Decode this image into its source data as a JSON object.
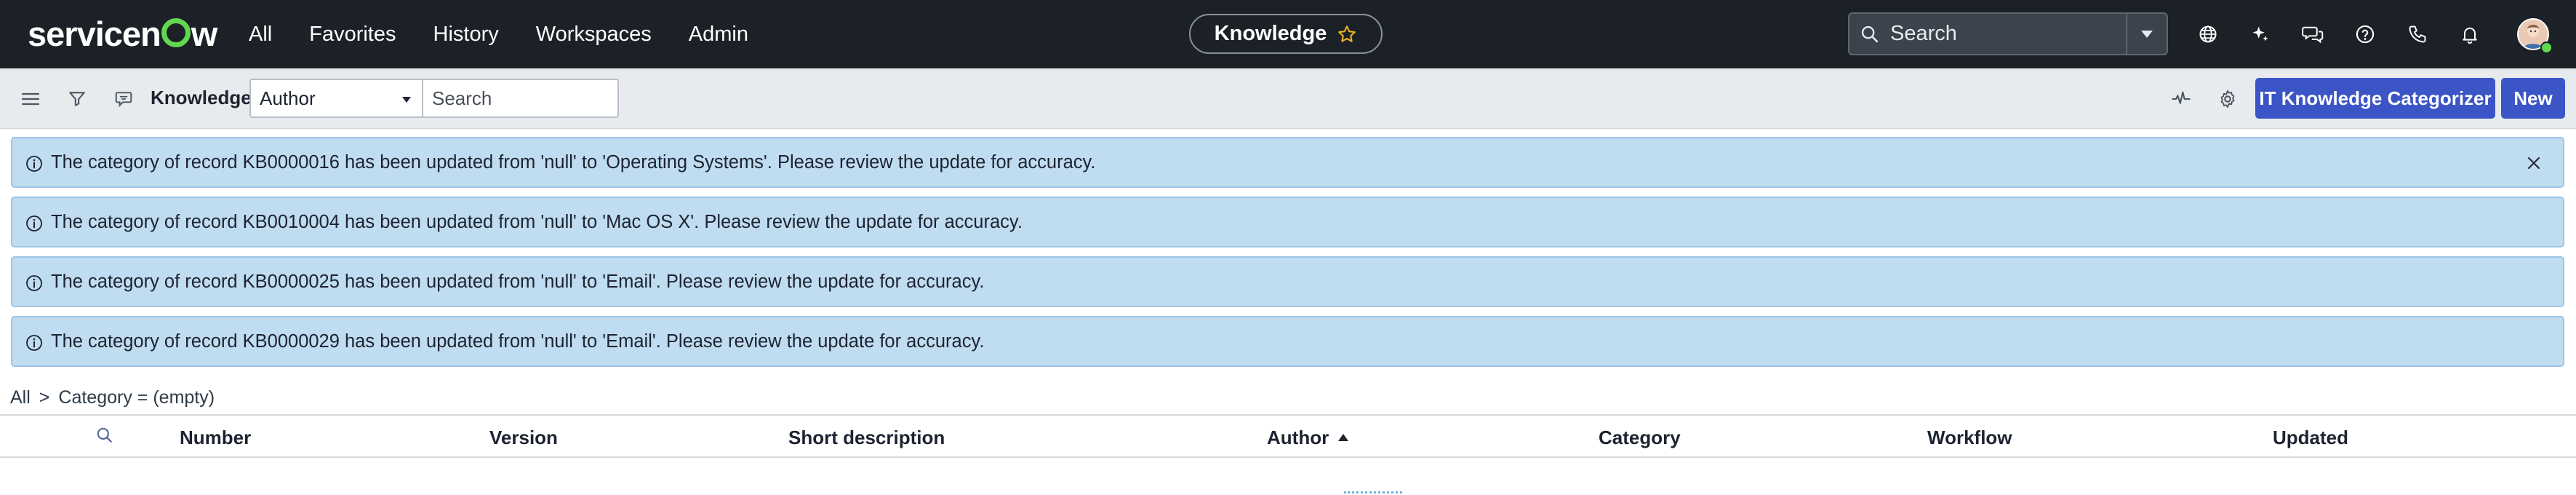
{
  "topnav": {
    "logo": "servicenow",
    "menu": [
      "All",
      "Favorites",
      "History",
      "Workspaces",
      "Admin"
    ],
    "context_title": "Knowledge",
    "search_placeholder": "Search",
    "icons": [
      "globe-icon",
      "sparkle-icon",
      "chat-icon",
      "help-icon",
      "phone-icon",
      "bell-icon"
    ]
  },
  "toolbar": {
    "title": "Knowledge",
    "field_select": "Author",
    "search_placeholder": "Search",
    "categorizer_button": "IT Knowledge Categorizer",
    "new_button": "New"
  },
  "banners": [
    "The category of record KB0000016 has been updated from 'null' to 'Operating Systems'. Please review the update for accuracy.",
    "The category of record KB0010004 has been updated from 'null' to 'Mac OS X'. Please review the update for accuracy.",
    "The category of record KB0000025 has been updated from 'null' to 'Email'. Please review the update for accuracy.",
    "The category of record KB0000029 has been updated from 'null' to 'Email'. Please review the update for accuracy."
  ],
  "breadcrumb": {
    "root": "All",
    "separator": ">",
    "condition": "Category = (empty)"
  },
  "table": {
    "columns": [
      "Number",
      "Version",
      "Short description",
      "Author",
      "Category",
      "Workflow",
      "Updated"
    ],
    "sorted_column": "Author",
    "sort_direction": "ascending"
  },
  "colors": {
    "nav_bg": "#1b2127",
    "logo_accent": "#62d84e",
    "toolbar_bg": "#e8ebee",
    "banner_bg": "#c0dcf1",
    "primary_button": "#3b55c7"
  }
}
